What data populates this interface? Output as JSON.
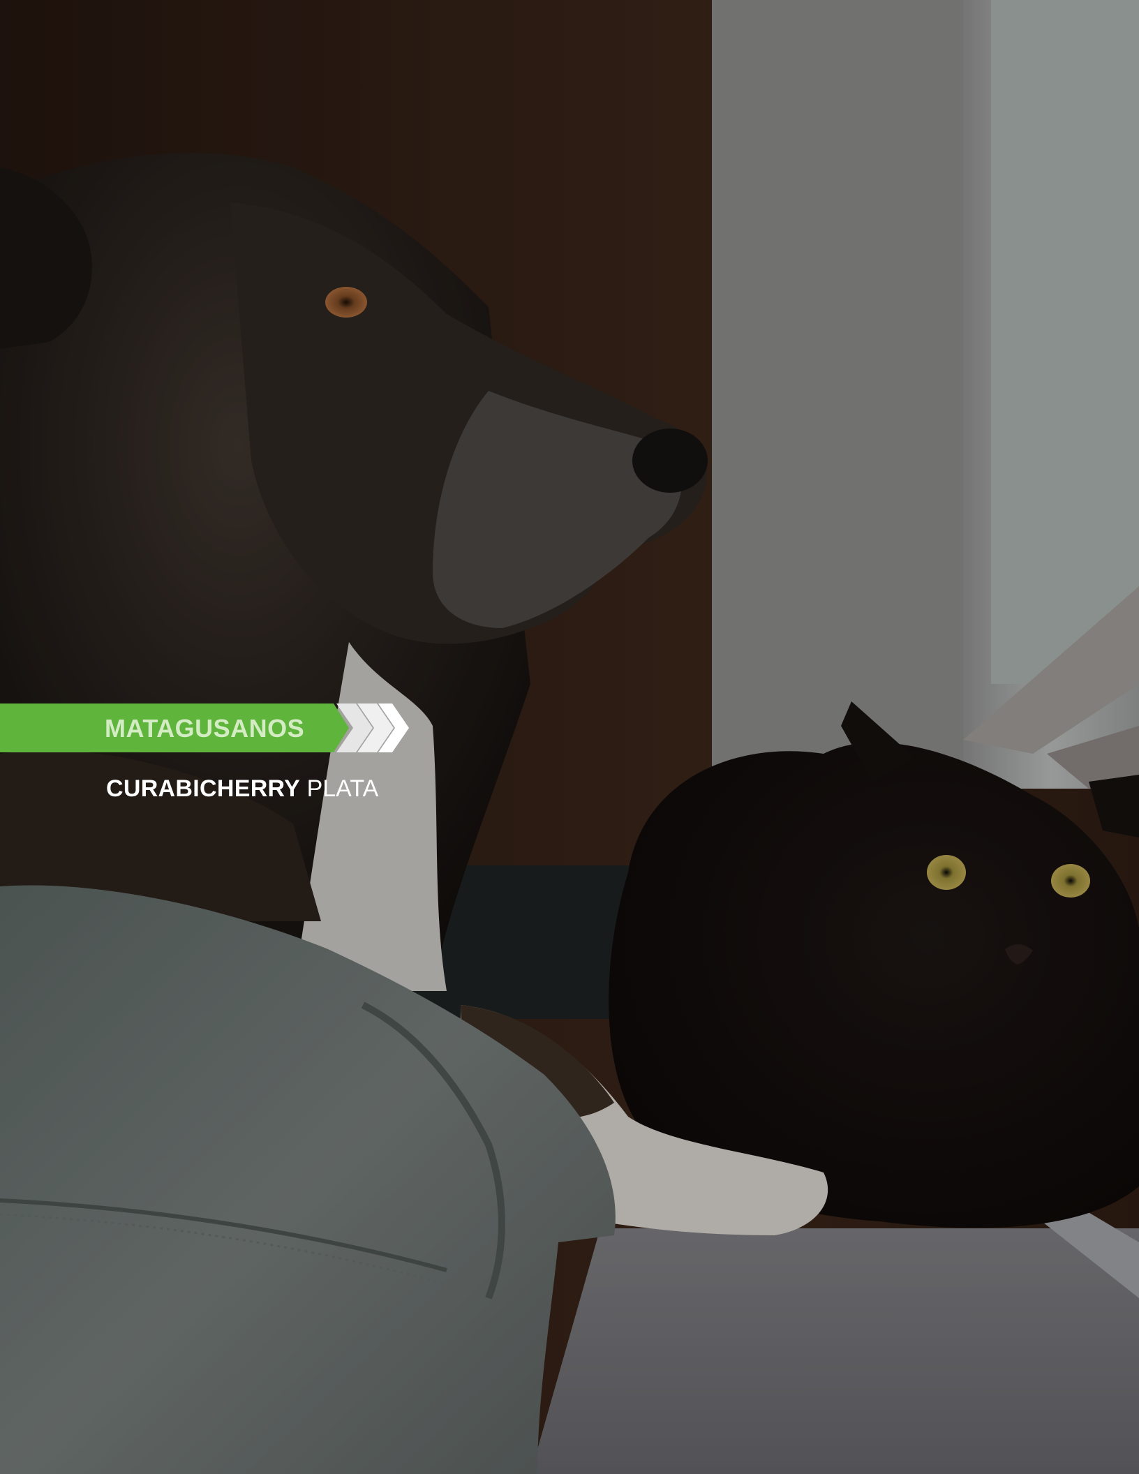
{
  "label": {
    "category": "MATAGUSANOS",
    "product_name": "CURABICHERRY",
    "product_variant": "PLATA"
  },
  "colors": {
    "accent_green": "#5fb43c",
    "category_text": "#d4ecc4",
    "subtitle_text": "#ffffff"
  },
  "icons": {
    "banner_chevrons": "chevron-right-icon"
  }
}
